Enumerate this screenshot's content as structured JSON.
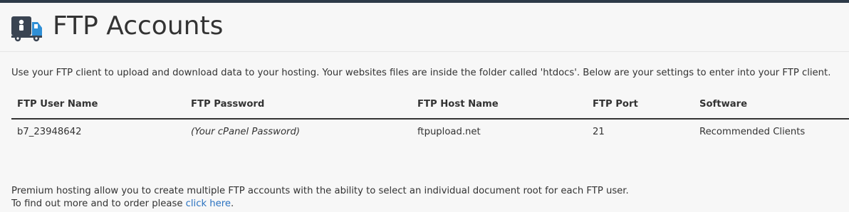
{
  "header": {
    "title": "FTP Accounts",
    "icon": "ftp-truck-icon"
  },
  "intro": {
    "text": "Use your FTP client to upload and download data to your hosting. Your websites files are inside the folder called 'htdocs'. Below are your settings to enter into your FTP client."
  },
  "table": {
    "columns": [
      "FTP User Name",
      "FTP Password",
      "FTP Host Name",
      "FTP Port",
      "Software"
    ],
    "rows": [
      {
        "user": "b7_23948642",
        "password": "(Your cPanel Password)",
        "host": "ftpupload.net",
        "port": "21",
        "software": "Recommended Clients"
      }
    ]
  },
  "footer": {
    "line1": "Premium hosting allow you to create multiple FTP accounts with the ability to select an individual document root for each FTP user.",
    "line2_prefix": "To find out more and to order please ",
    "line2_link": "click here",
    "line2_suffix": "."
  },
  "colors": {
    "link": "#2a72c0",
    "text": "#333333",
    "background": "#f7f7f7",
    "top_bar": "#2d3a48",
    "icon_dark": "#3a4452",
    "icon_accent": "#2f8fd6"
  }
}
